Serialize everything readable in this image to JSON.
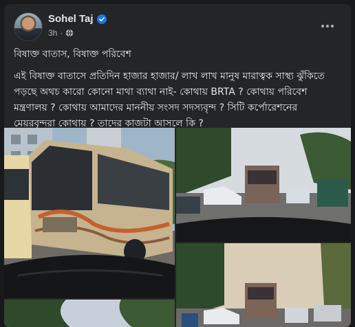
{
  "post": {
    "author": "Sohel Taj",
    "time": "3h",
    "separator": "·",
    "title": "বিষাক্ত বাতাস, বিষাক্ত পরিবেশ",
    "body": "এই বিষাক্ত বাতাসে প্রতিদিন হাজার হাজার/ লাখ লাখ মানুষ মারাত্বক সাস্থ্য ঝুঁকিতে পড়ছে অথচ কারো কোনো মাথা ব্যাথা নাই- কোথায় BRTA ? কোথায় পরিবেশ মন্ত্রণালয় ? কোথায় আমাদের মাননীয় সংসদ সদস্যবৃন্দ ? সিটি কর্পোরেশনের মেয়রবৃন্দরা কোথায় ? তাদের কাজটা আসলে কি ?"
  },
  "icons": {
    "verified": "verified-badge-icon",
    "audience": "globe-icon",
    "more": "more-options-icon"
  },
  "colors": {
    "background": "#18191a",
    "card": "#242526",
    "text_primary": "#e4e6eb",
    "text_secondary": "#b0b3b8",
    "verified_blue": "#1877f2"
  },
  "photos": [
    {
      "subject": "polluted-bus"
    },
    {
      "subject": "traffic-street-top"
    },
    {
      "subject": "traffic-street-bottom"
    },
    {
      "subject": "trees-sky"
    }
  ]
}
